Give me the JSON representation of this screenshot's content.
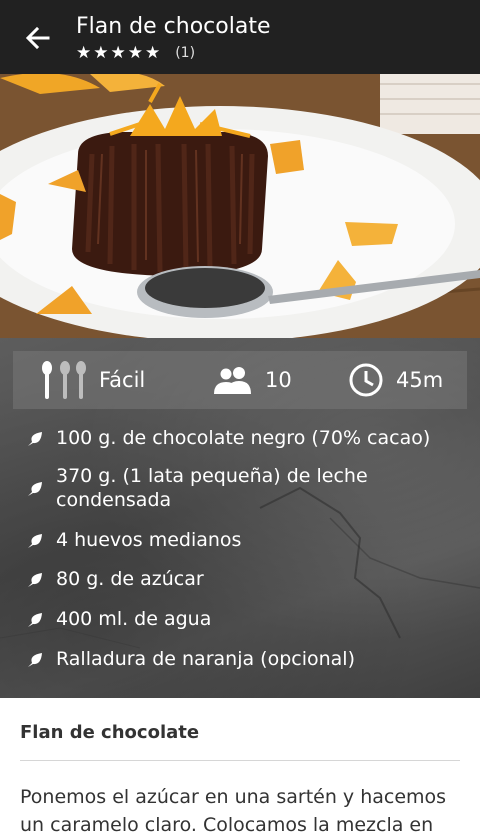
{
  "app_bar": {
    "title": "Flan de chocolate",
    "stars": "★★★★★",
    "rating_count": "(1)"
  },
  "hero": {
    "icon": "flan-photo"
  },
  "info": {
    "difficulty": "Fácil",
    "servings": "10",
    "time": "45m"
  },
  "ingredients": [
    "100 g. de chocolate negro (70% cacao)",
    "370 g. (1 lata pequeña) de leche condensada",
    "4 huevos medianos",
    "80 g. de azúcar",
    "400 ml. de agua",
    "Ralladura de naranja (opcional)"
  ],
  "description": {
    "title": "Flan de chocolate",
    "body": "Ponemos el azúcar en una sartén y hacemos un caramelo claro. Colocamos la mezcla en"
  },
  "colors": {
    "app_bar": "#212121",
    "slate": "#4f4f4f",
    "text_light": "#ffffff",
    "text_dark": "#333333"
  }
}
